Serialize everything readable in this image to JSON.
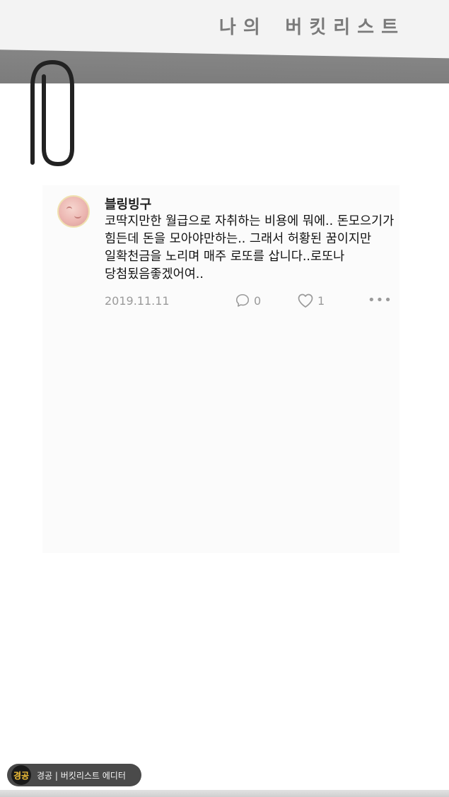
{
  "header": {
    "title": "나의 버킷리스트"
  },
  "post": {
    "username": "블링빙구",
    "text": "코딱지만한 월급으로 자취하는 비용에 뭐에.. 돈모으기가 힘든데 돈을 모아야만하는.. 그래서 허황된 꿈이지만 일확천금을 노리며 매주 로또를 삽니다..로또나 당첨됬음좋겠어여..",
    "date": "2019.11.11",
    "comment_count": "0",
    "like_count": "1",
    "more_label": "•••"
  },
  "footer": {
    "logo_text": "경공",
    "text": "경공 | 버킷리스트 에디터"
  },
  "icons": {
    "avatar": "avatar-icon",
    "comment": "comment-icon",
    "like": "heart-icon",
    "more": "more-icon",
    "paperclip": "paperclip-icon"
  },
  "colors": {
    "tape": "#7a7a7a",
    "meta_text": "#9a9a9a",
    "footer_bg": "#4a4a4a",
    "footer_logo": "#f6c43a"
  }
}
